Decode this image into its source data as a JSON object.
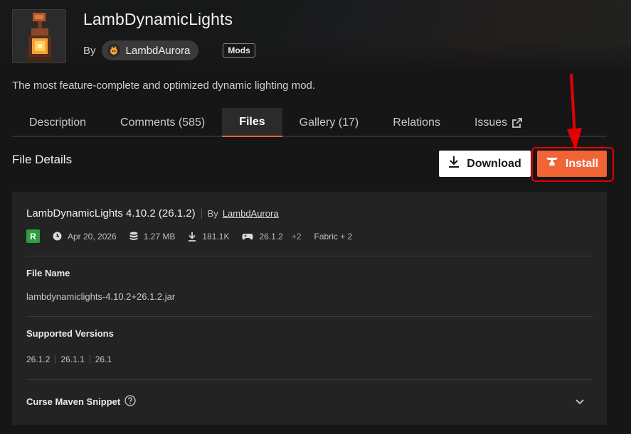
{
  "header": {
    "mod_title": "LambDynamicLights",
    "by_label": "By",
    "author": "LambdAurora",
    "category_badge": "Mods",
    "summary": "The most feature-complete and optimized dynamic lighting mod."
  },
  "tabs": [
    {
      "label": "Description",
      "active": false
    },
    {
      "label": "Comments (585)",
      "active": false
    },
    {
      "label": "Files",
      "active": true
    },
    {
      "label": "Gallery (17)",
      "active": false
    },
    {
      "label": "Relations",
      "active": false
    },
    {
      "label": "Issues",
      "active": false,
      "icon": "external-link-icon"
    }
  ],
  "actions": {
    "section_title": "File Details",
    "download_label": "Download",
    "install_label": "Install"
  },
  "file": {
    "name_title": "LambDynamicLights 4.10.2 (26.1.2)",
    "by_label": "By",
    "uploader": "LambdAurora",
    "release_type": "R",
    "date": "Apr 20, 2026",
    "size": "1.27 MB",
    "downloads": "181.1K",
    "game_version": "26.1.2",
    "game_version_more": "+2",
    "loader": "Fabric + 2",
    "file_name_label": "File Name",
    "file_name": "lambdynamiclights-4.10.2+26.1.2.jar",
    "supported_versions_label": "Supported Versions",
    "supported_versions": [
      "26.1.2",
      "26.1.1",
      "26.1"
    ],
    "maven_label": "Curse Maven Snippet"
  },
  "colors": {
    "accent": "#f16436",
    "highlight_box": "#e60000",
    "release_green": "#2e9e3e",
    "background": "#161616",
    "card": "#232323"
  }
}
